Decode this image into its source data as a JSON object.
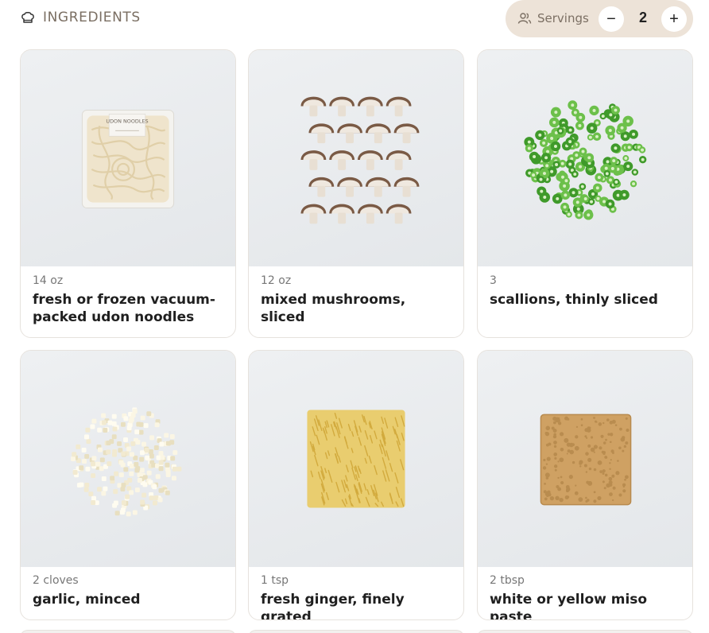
{
  "header": {
    "title": "INGREDIENTS",
    "title_icon": "chef-hat-icon",
    "servings_label": "Servings",
    "servings_icon": "users-icon",
    "servings_value": "2",
    "decrement_label": "−",
    "increment_label": "+"
  },
  "colors": {
    "servings_pill": "#ede3d8",
    "title_text": "#7a6e62",
    "card_border": "#e6e2dd"
  },
  "ingredients": [
    {
      "quantity": "14 oz",
      "name": "fresh or frozen vacuum-packed udon noodles",
      "image": "udon-noodles-package",
      "package_text": "UDON NOODLES"
    },
    {
      "quantity": "12 oz",
      "name": "mixed mushrooms, sliced",
      "image": "sliced-mushrooms"
    },
    {
      "quantity": "3",
      "name": "scallions, thinly sliced",
      "image": "sliced-scallions"
    },
    {
      "quantity": "2 cloves",
      "name": "garlic, minced",
      "image": "minced-garlic"
    },
    {
      "quantity": "1 tsp",
      "name": "fresh ginger, finely grated",
      "image": "grated-ginger"
    },
    {
      "quantity": "2 tbsp",
      "name": "white or yellow miso paste",
      "image": "miso-paste"
    }
  ]
}
